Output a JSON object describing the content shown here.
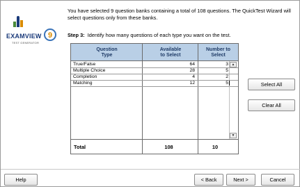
{
  "intro_text": "You have selected 9 question banks containing a total of 108 questions.  The QuickTest Wizard will select questions only from these banks.",
  "step": {
    "label": "Step 3:",
    "text": "Identify how many questions of each type you want on the test."
  },
  "logo": {
    "word": "EXAMVIEW",
    "sub": "TEST GENERATOR",
    "version": "9"
  },
  "table": {
    "headers": {
      "type": "Question\nType",
      "available": "Available\nto Select",
      "number": "Number to\nSelect"
    },
    "rows": [
      {
        "type": "True/False",
        "available": "64",
        "number": "3"
      },
      {
        "type": "Multiple Choice",
        "available": "28",
        "number": "5"
      },
      {
        "type": "Completion",
        "available": "4",
        "number": "2"
      },
      {
        "type": "Matching",
        "available": "12",
        "number": "5"
      }
    ],
    "total": {
      "label": "Total",
      "available": "108",
      "number": "10"
    }
  },
  "buttons": {
    "select_all": "Select All",
    "clear_all": "Clear All",
    "help": "Help",
    "back": "< Back",
    "next": "Next >",
    "cancel": "Cancel"
  },
  "colors": {
    "header_bg": "#b9cfe6",
    "header_text": "#1e3a66",
    "logo_blue": "#1a3a7a",
    "logo_accent": "#d98b00"
  },
  "icons": {
    "spinner_up": "scroll-up-arrow-icon",
    "spinner_down": "scroll-down-arrow-icon"
  }
}
